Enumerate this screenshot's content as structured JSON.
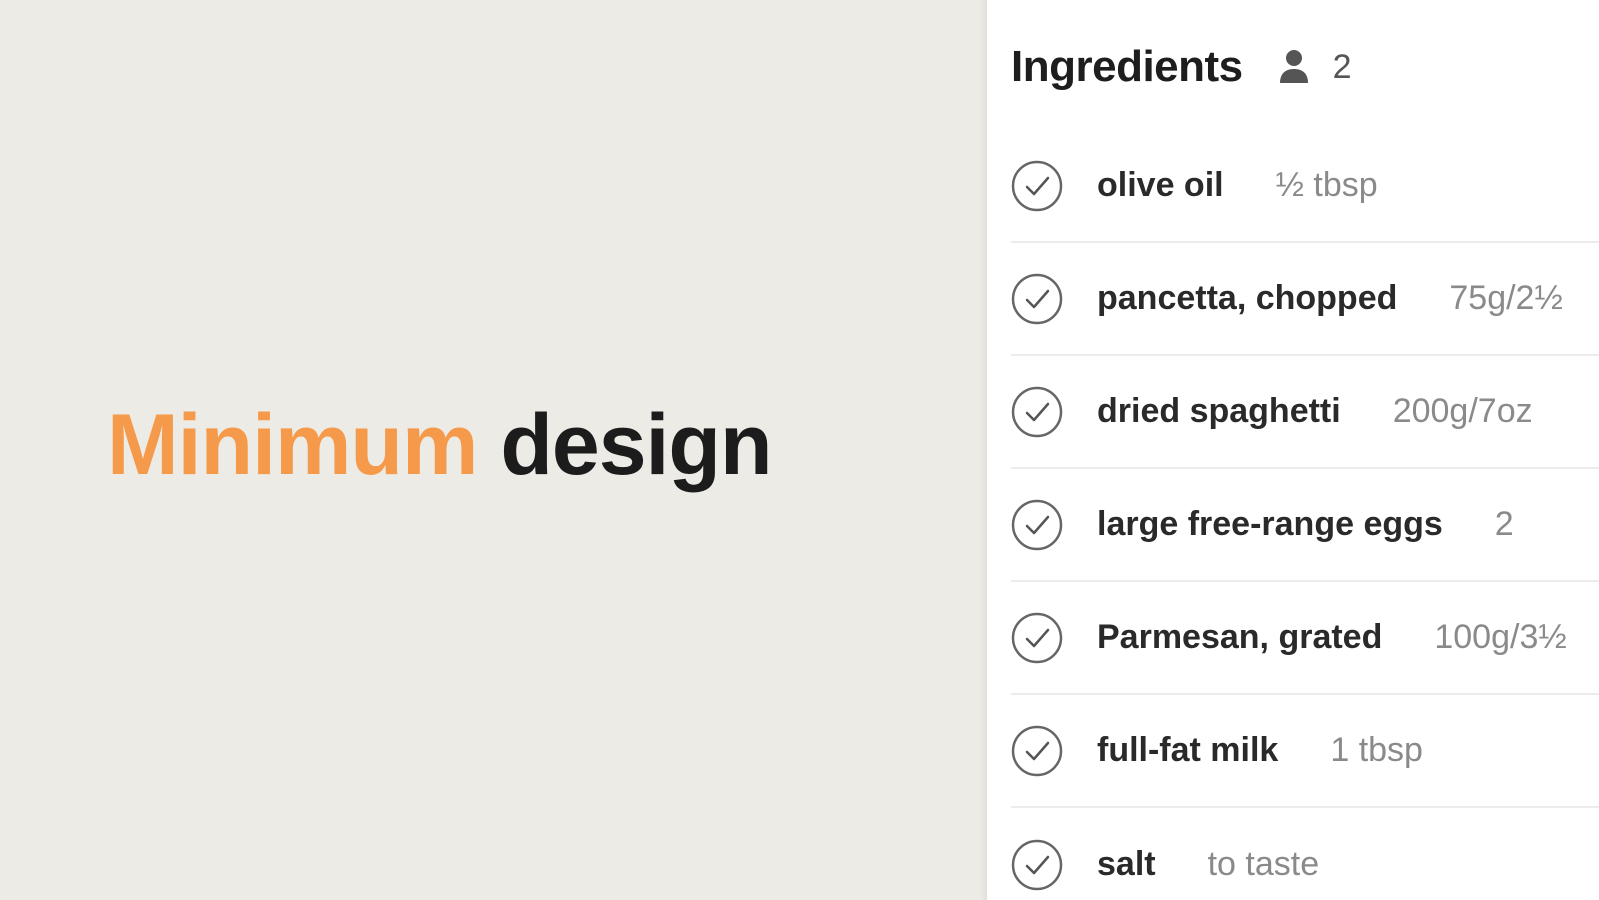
{
  "headline": {
    "accent_word": "Minimum",
    "rest": "design",
    "accent_color": "#f59a4a"
  },
  "panel": {
    "title": "Ingredients",
    "servings_icon": "person-icon",
    "servings": "2",
    "items": [
      {
        "name": "olive oil",
        "quantity": "½ tbsp"
      },
      {
        "name": "pancetta, chopped",
        "quantity": "75g/2½"
      },
      {
        "name": "dried spaghetti",
        "quantity": "200g/7oz"
      },
      {
        "name": "large free-range eggs",
        "quantity": "2"
      },
      {
        "name": "Parmesan, grated",
        "quantity": "100g/3½"
      },
      {
        "name": "full-fat milk",
        "quantity": "1 tbsp"
      },
      {
        "name": "salt",
        "quantity": "to taste"
      }
    ]
  }
}
